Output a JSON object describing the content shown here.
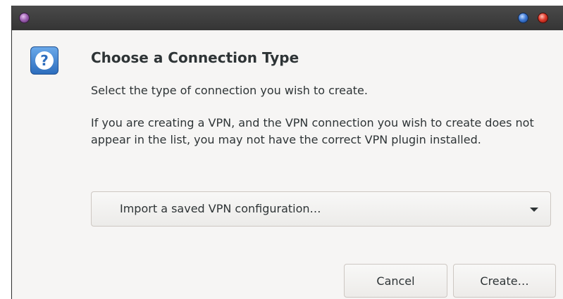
{
  "window": {
    "title": "",
    "controls": {
      "menu_color": "#a064b4",
      "minimize_color": "#3f7ad6",
      "close_color": "#df3b2c"
    }
  },
  "dialog": {
    "icon": "question-icon",
    "icon_glyph": "?",
    "title": "Choose a Connection Type",
    "subtitle": "Select the type of connection you wish to create.",
    "description": "If you are creating a VPN, and the VPN connection you wish to create does not appear in the list, you may not have the correct VPN plugin installed.",
    "connection_type": {
      "selected": "Import a saved VPN configuration…"
    },
    "buttons": {
      "cancel_label": "Cancel",
      "create_label": "Create…"
    }
  }
}
